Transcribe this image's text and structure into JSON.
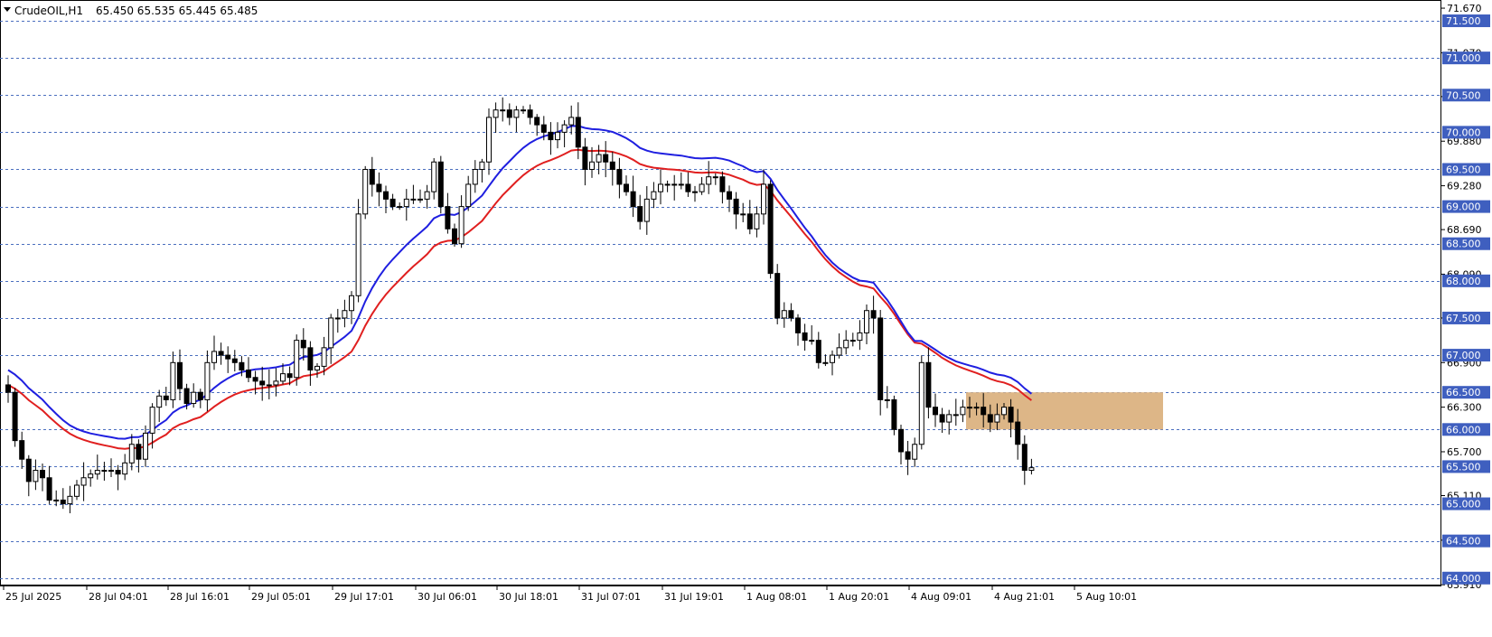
{
  "header": {
    "symbol": "CrudeOIL,H1",
    "ohlc": "65.450 65.535 65.445 65.485"
  },
  "chart_data": {
    "type": "candlestick",
    "symbol": "CrudeOIL",
    "timeframe": "H1",
    "ylim": [
      63.9,
      71.78
    ],
    "grid": true,
    "price_ticks": [
      "71.670",
      "71.070",
      "70.480",
      "69.880",
      "69.280",
      "68.690",
      "68.090",
      "67.500",
      "66.900",
      "66.300",
      "65.700",
      "65.110",
      "64.510",
      "63.910"
    ],
    "levels": [
      "71.500",
      "71.000",
      "70.500",
      "70.000",
      "69.500",
      "69.000",
      "68.500",
      "68.000",
      "67.500",
      "67.000",
      "66.500",
      "66.000",
      "65.500",
      "65.000",
      "64.500",
      "64.000"
    ],
    "time_labels": [
      "25 Jul 2025",
      "28 Jul 04:01",
      "28 Jul 16:01",
      "29 Jul 05:01",
      "29 Jul 17:01",
      "30 Jul 06:01",
      "30 Jul 18:01",
      "31 Jul 07:01",
      "31 Jul 19:01",
      "1 Aug 08:01",
      "1 Aug 20:01",
      "4 Aug 09:01",
      "4 Aug 21:01",
      "5 Aug 10:01"
    ],
    "zone": {
      "low": 66.0,
      "high": 66.5,
      "color": "#ddb687"
    },
    "colors": {
      "bull": "#ffffff",
      "bear": "#000000",
      "ma_fast": "#1f1fe0",
      "ma_slow": "#e01f1f",
      "grid": "#4b6fbf",
      "level_tag": "#3f5fbf"
    },
    "close": [
      66.5,
      65.85,
      65.6,
      65.3,
      65.45,
      65.35,
      65.05,
      65.05,
      65.0,
      65.1,
      65.25,
      65.35,
      65.4,
      65.45,
      65.45,
      65.45,
      65.4,
      65.55,
      65.8,
      65.6,
      65.95,
      66.3,
      66.45,
      66.4,
      66.9,
      66.55,
      66.35,
      66.5,
      66.4,
      66.9,
      67.05,
      67.0,
      66.95,
      66.9,
      66.8,
      66.7,
      66.65,
      66.6,
      66.6,
      66.65,
      66.75,
      66.7,
      67.2,
      67.1,
      66.8,
      66.85,
      67.1,
      67.5,
      67.5,
      67.6,
      67.8,
      68.9,
      69.5,
      69.3,
      69.2,
      69.1,
      69.0,
      69.0,
      69.1,
      69.1,
      69.1,
      69.2,
      69.6,
      69.0,
      68.7,
      68.5,
      69.0,
      69.3,
      69.5,
      69.6,
      70.2,
      70.3,
      70.3,
      70.2,
      70.3,
      70.3,
      70.2,
      70.1,
      70.0,
      69.9,
      70.0,
      70.1,
      70.2,
      69.8,
      69.5,
      69.6,
      69.7,
      69.6,
      69.5,
      69.3,
      69.2,
      69.0,
      68.8,
      69.1,
      69.2,
      69.3,
      69.3,
      69.3,
      69.3,
      69.2,
      69.2,
      69.3,
      69.4,
      69.4,
      69.2,
      69.1,
      68.9,
      68.9,
      68.7,
      68.9,
      69.3,
      68.1,
      67.5,
      67.6,
      67.5,
      67.3,
      67.2,
      67.2,
      66.9,
      66.9,
      67.0,
      67.1,
      67.2,
      67.2,
      67.3,
      67.6,
      67.5,
      66.4,
      66.4,
      66.0,
      65.7,
      65.6,
      65.8,
      66.9,
      66.3,
      66.2,
      66.1,
      66.2,
      66.2,
      66.3,
      66.3,
      66.3,
      66.2,
      66.1,
      66.2,
      66.3,
      66.1,
      65.8,
      65.45,
      65.485
    ]
  }
}
